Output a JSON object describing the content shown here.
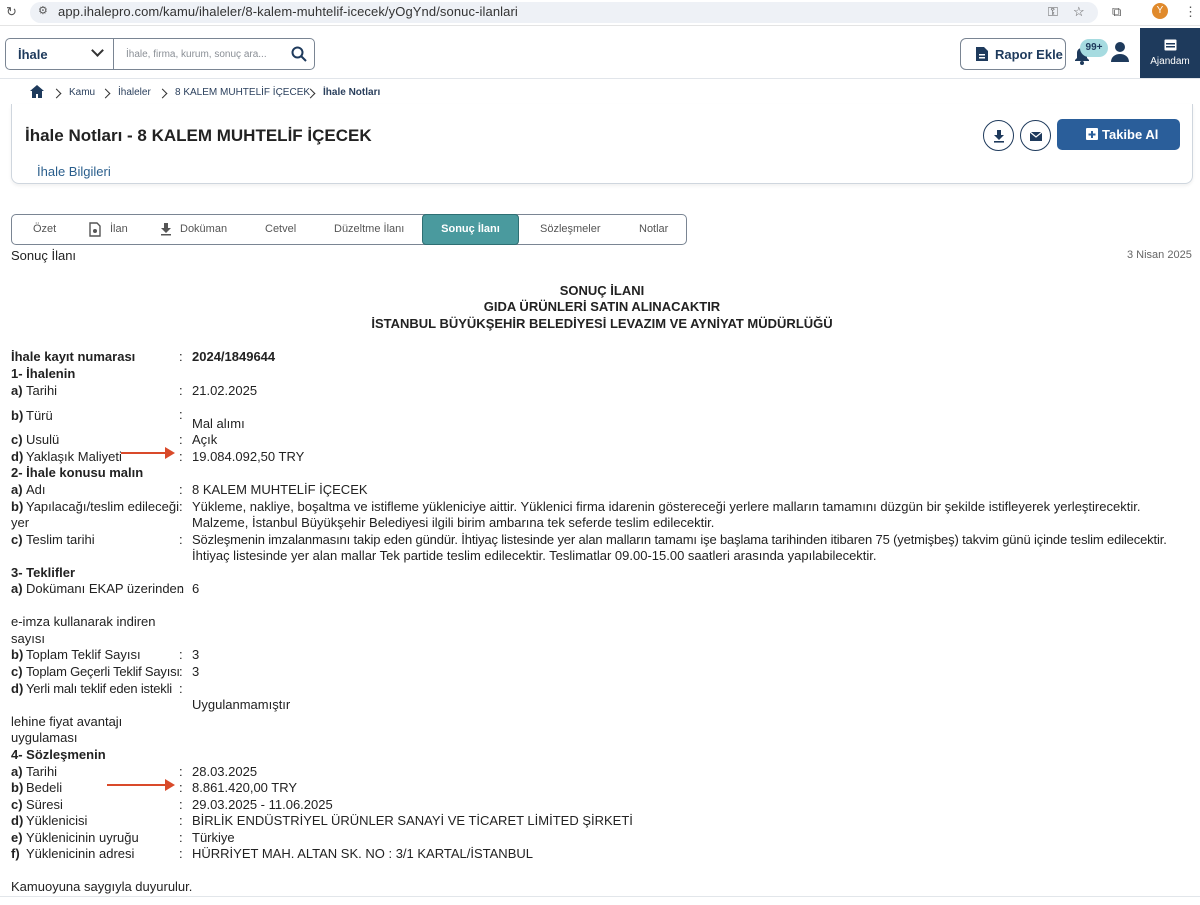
{
  "browser": {
    "url": "app.ihalepro.com/kamu/ihaleler/8-kalem-muhtelif-icecek/yOgYnd/sonuc-ilanlari",
    "avatar": "Y"
  },
  "header": {
    "select_value": "İhale",
    "search_placeholder": "İhale, firma, kurum, sonuç ara...",
    "rapor_label": "Rapor Ekle",
    "notif_count": "99+",
    "ajandam_label": "Ajandam"
  },
  "breadcrumb": [
    "Kamu",
    "İhaleler",
    "8 KALEM MUHTELİF İÇECEK",
    "İhale Notları"
  ],
  "page": {
    "title": "İhale Notları - 8 KALEM MUHTELİF İÇECEK",
    "info_link": "İhale Bilgileri",
    "takibe_label": "Takibe Al"
  },
  "tabs": [
    "Özet",
    "İlan",
    "Doküman",
    "Cetvel",
    "Düzeltme İlanı",
    "Sonuç İlanı",
    "Sözleşmeler",
    "Notlar"
  ],
  "active_tab": "Sonuç İlanı",
  "doc": {
    "section_label": "Sonuç İlanı",
    "date": "3 Nisan 2025",
    "heading1": "SONUÇ İLANI",
    "heading2": "GIDA ÜRÜNLERİ SATIN ALINACAKTIR",
    "heading3": "İSTANBUL BÜYÜKŞEHİR BELEDİYESİ LEVAZIM VE AYNİYAT MÜDÜRLÜĞÜ",
    "kayit_label": "İhale kayıt numarası",
    "kayit_value": "2024/1849644",
    "s1": "1- İhalenin",
    "s1a_k": "a)",
    "s1a_l": "Tarihi",
    "s1a_v": "21.02.2025",
    "s1b_k": "b)",
    "s1b_l": "Türü",
    "s1b_v": "Mal alımı",
    "s1c_k": "c)",
    "s1c_l": "Usulü",
    "s1c_v": "Açık",
    "s1d_k": "d)",
    "s1d_l": "Yaklaşık Maliyeti",
    "s1d_v": "19.084.092,50 TRY",
    "s2": "2- İhale konusu malın",
    "s2a_k": "a)",
    "s2a_l": "Adı",
    "s2a_v": "8 KALEM MUHTELİF İÇECEK",
    "s2b_k": "b)",
    "s2b_l1": "Yapılacağı/teslim edileceği",
    "s2b_l2": "yer",
    "s2b_v1": "Yükleme, nakliye, boşaltma ve istifleme yükleniciye aittir. Yüklenici firma idarenin göstereceği yerlere malların tamamını düzgün bir şekilde istifleyerek yerleştirecektir.",
    "s2b_v2": "Malzeme, İstanbul Büyükşehir Belediyesi ilgili birim ambarına tek seferde teslim edilecektir.",
    "s2c_k": "c)",
    "s2c_l": "Teslim tarihi",
    "s2c_v1": "Sözleşmenin imzalanmasını takip eden gündür. İhtiyaç listesinde yer alan malların tamamı işe başlama tarihinden itibaren 75 (yetmişbeş) takvim günü içinde teslim edilecektir.",
    "s2c_v2": "İhtiyaç listesinde yer alan mallar Tek partide teslim edilecektir. Teslimatlar 09.00-15.00 saatleri arasında yapılabilecektir.",
    "s3": "3- Teklifler",
    "s3a_k": "a)",
    "s3a_l1": "Dokümanı EKAP üzerinden",
    "s3a_v": "6",
    "s3a_l2": "e-imza kullanarak indiren",
    "s3a_l3": "sayısı",
    "s3b_k": "b)",
    "s3b_l": "Toplam Teklif Sayısı",
    "s3b_v": "3",
    "s3c_k": "c)",
    "s3c_l": "Toplam Geçerli Teklif Sayısı",
    "s3c_v": "3",
    "s3d_k": "d)",
    "s3d_l1": "Yerli malı teklif eden istekli",
    "s3d_v": "Uygulanmamıştır",
    "s3d_l2": "lehine fiyat avantajı",
    "s3d_l3": "uygulaması",
    "s4": "4- Sözleşmenin",
    "s4a_k": "a)",
    "s4a_l": "Tarihi",
    "s4a_v": "28.03.2025",
    "s4b_k": "b)",
    "s4b_l": "Bedeli",
    "s4b_v": "8.861.420,00 TRY",
    "s4c_k": "c)",
    "s4c_l": "Süresi",
    "s4c_v": "29.03.2025 - 11.06.2025",
    "s4d_k": "d)",
    "s4d_l": "Yüklenicisi",
    "s4d_v": "BİRLİK ENDÜSTRİYEL ÜRÜNLER SANAYİ VE TİCARET LİMİTED ŞİRKETİ",
    "s4e_k": "e)",
    "s4e_l": "Yüklenicinin uyruğu",
    "s4e_v": "Türkiye",
    "s4f_k": "f)",
    "s4f_l": "Yüklenicinin adresi",
    "s4f_v": "HÜRRİYET MAH. ALTAN SK. NO : 3/1 KARTAL/İSTANBUL",
    "footer": "Kamuoyuna saygıyla duyurulur.",
    "colon": ":"
  },
  "colors": {
    "navy": "#1e3a5c",
    "teal": "#4a9a9e",
    "blue_btn": "#2a5e9a",
    "arrow": "#d94a2a"
  }
}
